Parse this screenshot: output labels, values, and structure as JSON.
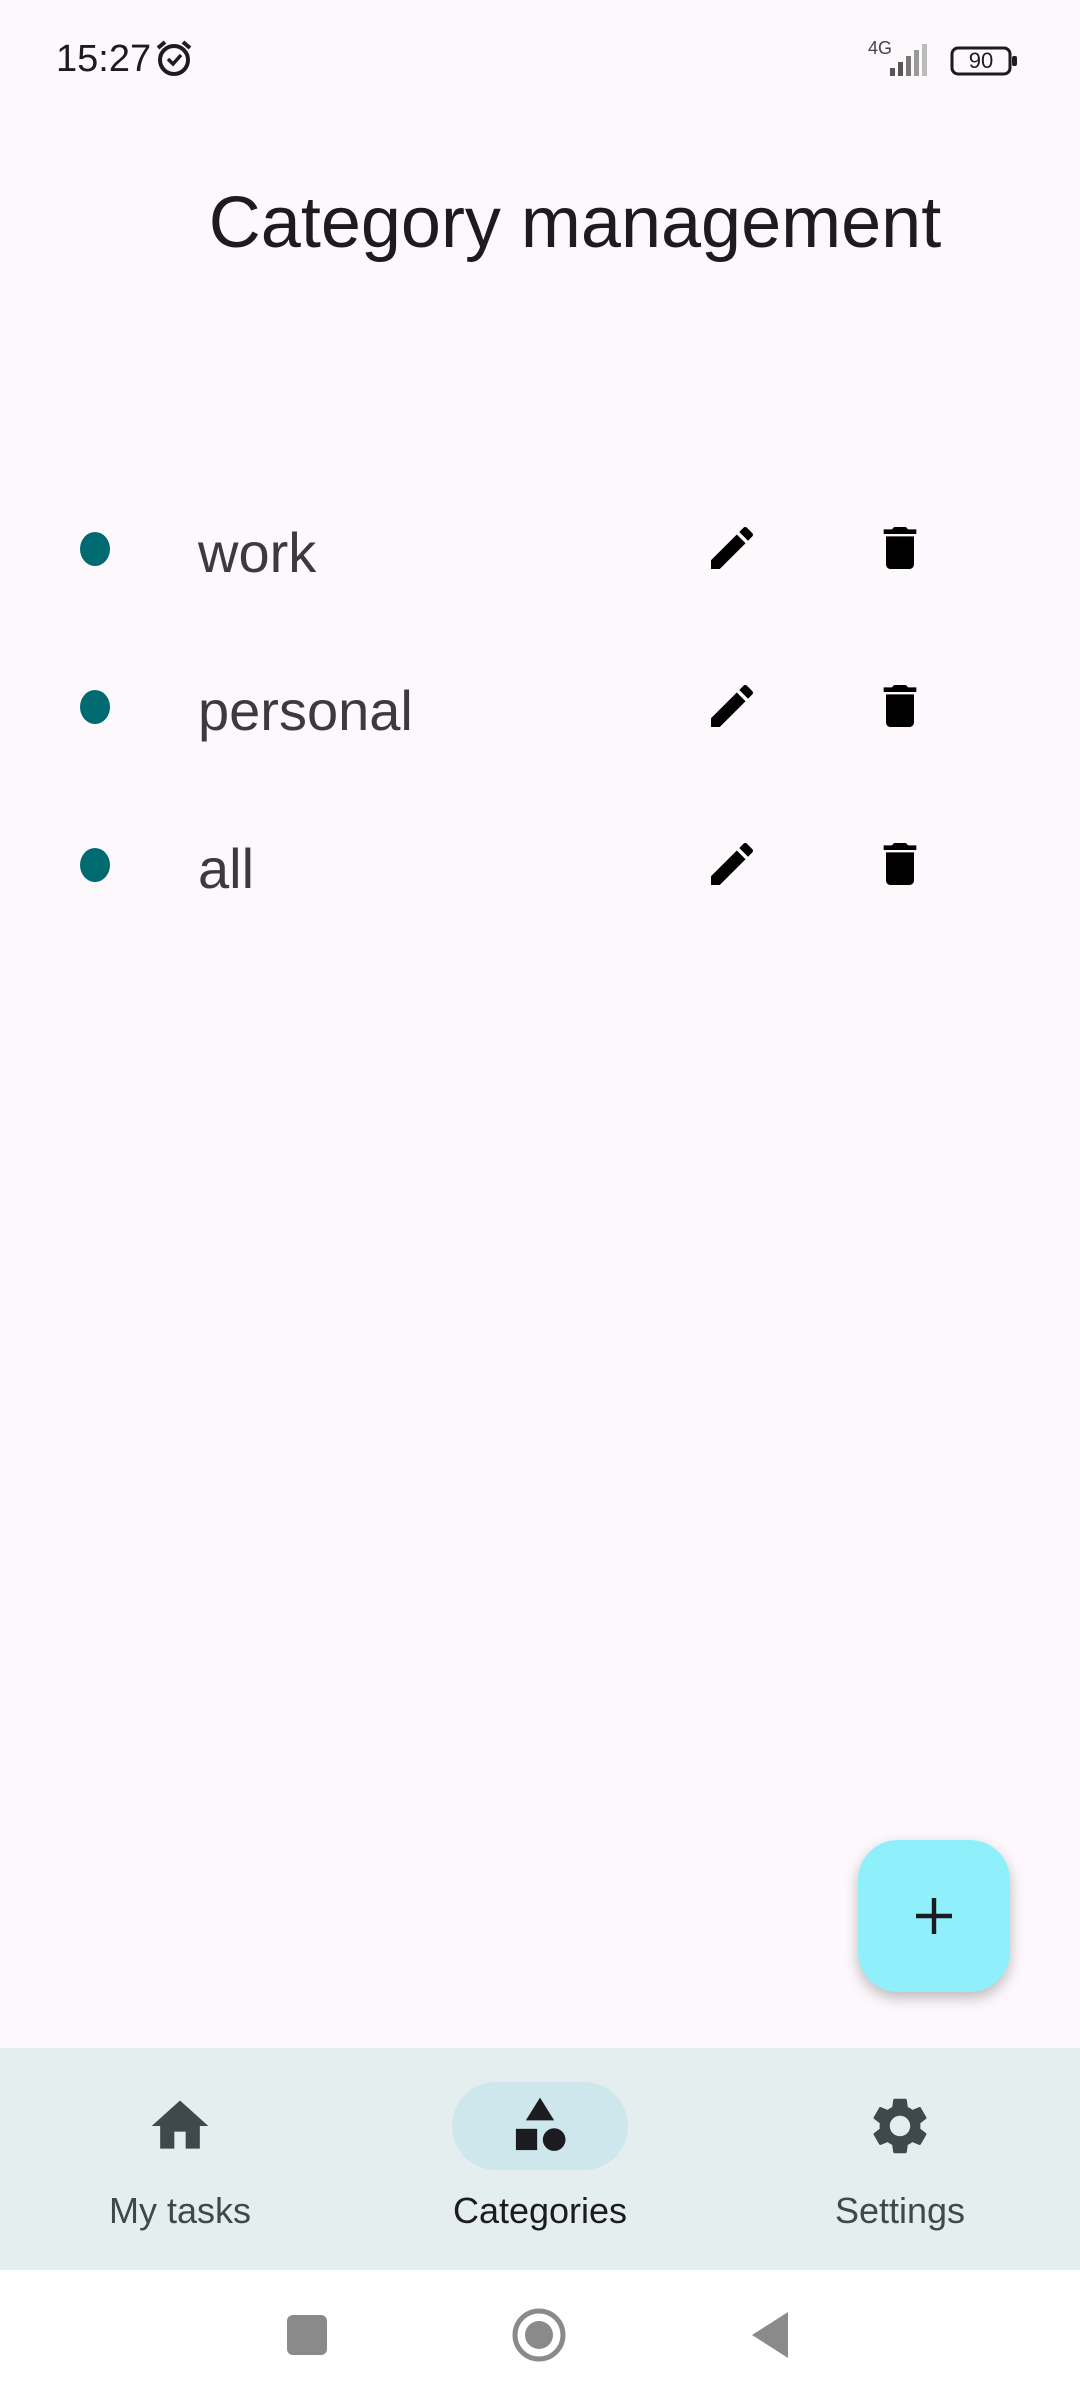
{
  "status_bar": {
    "time": "15:27",
    "network": "4G",
    "battery": "90",
    "icons": [
      "alarm-icon",
      "signal-icon",
      "battery-icon"
    ]
  },
  "page": {
    "title": "Category management"
  },
  "categories": [
    {
      "label": "work",
      "color": "#006a71"
    },
    {
      "label": "personal",
      "color": "#006a71"
    },
    {
      "label": "all",
      "color": "#006a71"
    }
  ],
  "actions": {
    "edit_icon": "pencil-icon",
    "delete_icon": "trash-icon",
    "add_icon": "plus-icon"
  },
  "bottom_nav": {
    "items": [
      {
        "label": "My tasks",
        "icon": "home-icon",
        "active": false
      },
      {
        "label": "Categories",
        "icon": "shapes-icon",
        "active": true
      },
      {
        "label": "Settings",
        "icon": "gear-icon",
        "active": false
      }
    ]
  },
  "colors": {
    "background": "#fdf8fc",
    "fab": "#8ff0fb",
    "nav_background": "#e5eeef",
    "nav_active_pill": "#cde7ec",
    "category_dot": "#006a71"
  }
}
